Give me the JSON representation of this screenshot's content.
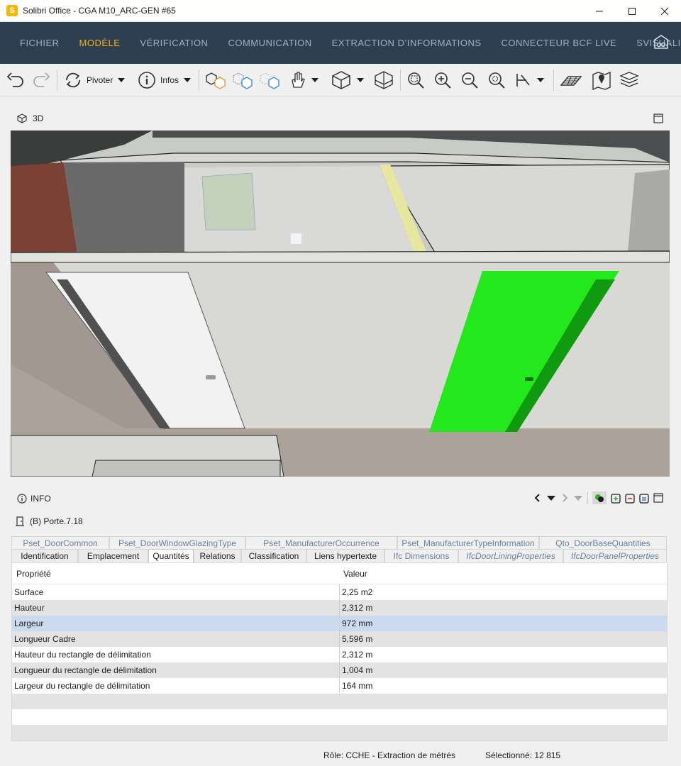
{
  "window": {
    "title": "Solibri Office - CGA M10_ARC-GEN #65",
    "logo_letter": "S"
  },
  "menu": {
    "items": [
      {
        "label": "FICHIER",
        "active": false
      },
      {
        "label": "MODÈLE",
        "active": true
      },
      {
        "label": "VÉRIFICATION",
        "active": false
      },
      {
        "label": "COMMUNICATION",
        "active": false
      },
      {
        "label": "EXTRACTION D’INFORMATIONS",
        "active": false
      },
      {
        "label": "CONNECTEUR BCF LIVE",
        "active": false
      },
      {
        "label": "SVISUALIS ALCUL",
        "active": false
      }
    ]
  },
  "toolbar": {
    "rotate_label": "Pivoter",
    "info_label": "Infos"
  },
  "view3d": {
    "title": "3D",
    "highlight_color": "#22e81c"
  },
  "info": {
    "title": "INFO",
    "selected_object": "(B) Porte.7.18",
    "tabs_row1": [
      "Pset_DoorCommon",
      "Pset_DoorWindowGlazingType",
      "Pset_ManufacturerOccurrence",
      "Pset_ManufacturerTypeInformation",
      "Qto_DoorBaseQuantities"
    ],
    "tabs_row2": [
      "Identification",
      "Emplacement",
      "Quantités",
      "Relations",
      "Classification",
      "Liens hypertexte",
      "Ifc Dimensions",
      "IfcDoorLiningProperties",
      "IfcDoorPanelProperties"
    ],
    "active_tab": "Quantités",
    "columns": [
      "Propriété",
      "Valeur"
    ],
    "rows": [
      {
        "property": "Surface",
        "value": "2,25 m2"
      },
      {
        "property": "Hauteur",
        "value": "2,312 m"
      },
      {
        "property": "Largeur",
        "value": "972 mm"
      },
      {
        "property": "Longueur Cadre",
        "value": "5,596 m"
      },
      {
        "property": "Hauteur du rectangle de délimitation",
        "value": "2,312 m"
      },
      {
        "property": "Longueur du rectangle de délimitation",
        "value": "1,004 m"
      },
      {
        "property": "Largeur du rectangle de délimitation",
        "value": "164 mm"
      }
    ],
    "selected_row": "Largeur"
  },
  "status": {
    "role": "Rôle: CCHE - Extraction de métrés",
    "selected": "Sélectionné: 12 815"
  }
}
